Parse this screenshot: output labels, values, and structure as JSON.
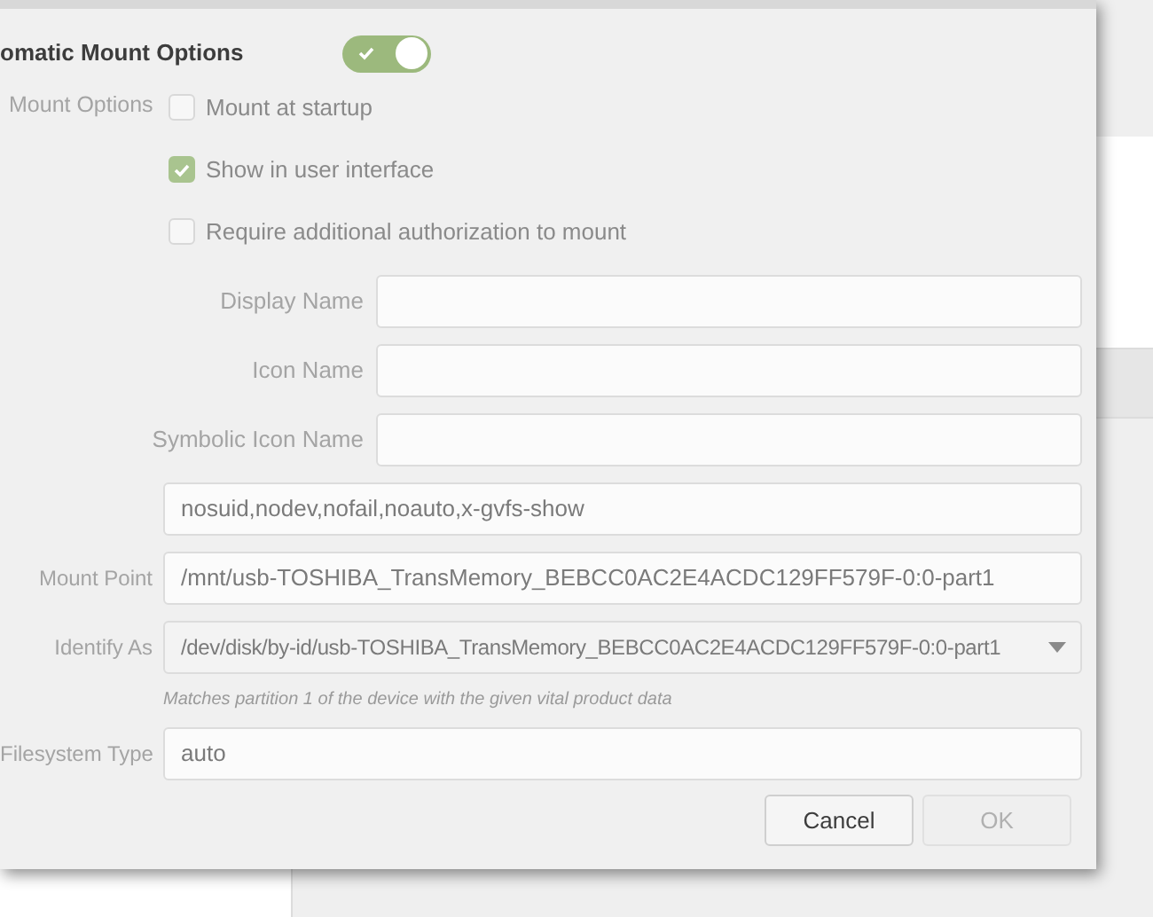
{
  "header": {
    "title": "omatic Mount Options",
    "switch_on": true
  },
  "mount_options": {
    "label": "Mount Options",
    "checkboxes": [
      {
        "label": "Mount at startup",
        "checked": false
      },
      {
        "label": "Show in user interface",
        "checked": true
      },
      {
        "label": "Require additional authorization to mount",
        "checked": false
      }
    ]
  },
  "name_fields": [
    {
      "label": "Display Name"
    },
    {
      "label": "Icon Name"
    },
    {
      "label": "Symbolic Icon Name"
    }
  ],
  "options_field": {
    "value": "nosuid,nodev,nofail,noauto,x-gvfs-show"
  },
  "mount_point": {
    "label": "Mount Point",
    "value": "/mnt/usb-TOSHIBA_TransMemory_BEBCC0AC2E4ACDC129FF579F-0:0-part1"
  },
  "identify_as": {
    "label": "Identify As",
    "value": "/dev/disk/by-id/usb-TOSHIBA_TransMemory_BEBCC0AC2E4ACDC129FF579F-0:0-part1",
    "hint": "Matches partition 1 of the device with the given vital product data"
  },
  "filesystem_type": {
    "label": "Filesystem Type",
    "value": "auto"
  },
  "buttons": [
    {
      "label": "Cancel",
      "disabled": false
    },
    {
      "label": "OK",
      "disabled": true
    }
  ]
}
